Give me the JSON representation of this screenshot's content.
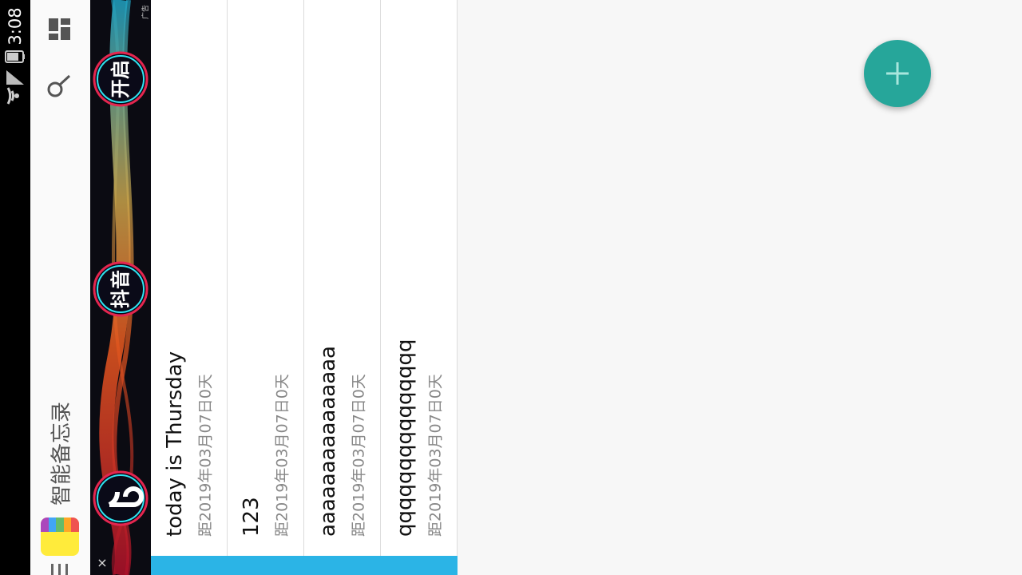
{
  "status_bar": {
    "time": "3:08",
    "icons": [
      "wifi-icon",
      "signal-icon",
      "battery-icon"
    ]
  },
  "app_bar": {
    "title": "智能备忘录",
    "actions": [
      "dashboard-icon",
      "search-icon",
      "menu-icon"
    ],
    "logo_colors": [
      "#ab47bc",
      "#42a5f5",
      "#66bb6a",
      "#ffa726",
      "#ef5350"
    ]
  },
  "ad": {
    "words": [
      "开启",
      "抖音"
    ],
    "close": "×",
    "tag": "广告"
  },
  "notes": [
    {
      "title": "today is Thursday",
      "subtitle": "距2019年03月07日0天"
    },
    {
      "title": "123",
      "subtitle": "距2019年03月07日0天"
    },
    {
      "title": "aaaaaaaaaaaaaaa",
      "subtitle": "距2019年03月07日0天"
    },
    {
      "title": "qqqqqqqqqqqqqqq",
      "subtitle": "距2019年03月07日0天"
    }
  ],
  "fab": {
    "icon": "plus-icon",
    "color": "#26a69a"
  },
  "colors": {
    "accent": "#26a69a",
    "strip": "#2bb4e6"
  }
}
